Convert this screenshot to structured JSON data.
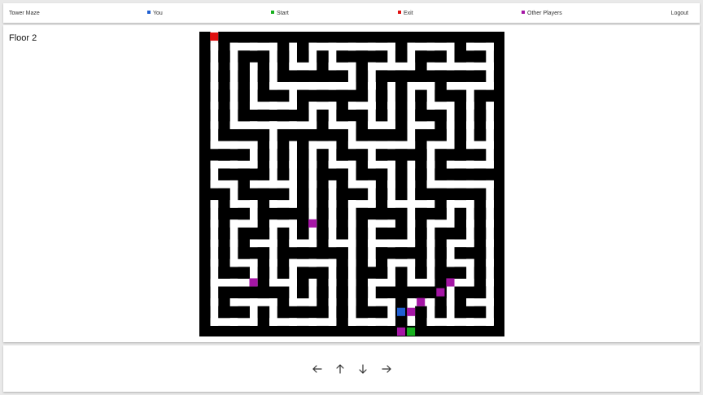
{
  "header": {
    "title": "Tower Maze",
    "legend": [
      {
        "label": "You",
        "color": "#1f5fd1"
      },
      {
        "label": "Start",
        "color": "#18b01f"
      },
      {
        "label": "Exit",
        "color": "#e01010"
      },
      {
        "label": "Other Players",
        "color": "#a516a5"
      }
    ],
    "logout_label": "Logout"
  },
  "floor": {
    "label": "Floor 2"
  },
  "maze": {
    "grid_size": 31,
    "wall_color": "#000000",
    "path_color": "#ffffff",
    "exit": {
      "col": 1,
      "row": 0
    },
    "start": {
      "col": 21,
      "row": 30
    },
    "you": {
      "col": 20,
      "row": 28
    },
    "other_players": [
      {
        "col": 11,
        "row": 19
      },
      {
        "col": 5,
        "row": 25
      },
      {
        "col": 25,
        "row": 25
      },
      {
        "col": 24,
        "row": 26
      },
      {
        "col": 22,
        "row": 27
      },
      {
        "col": 21,
        "row": 28
      },
      {
        "col": 20,
        "row": 30
      }
    ]
  },
  "controls": {
    "left": "left-arrow-icon",
    "up": "up-arrow-icon",
    "down": "down-arrow-icon",
    "right": "right-arrow-icon"
  }
}
